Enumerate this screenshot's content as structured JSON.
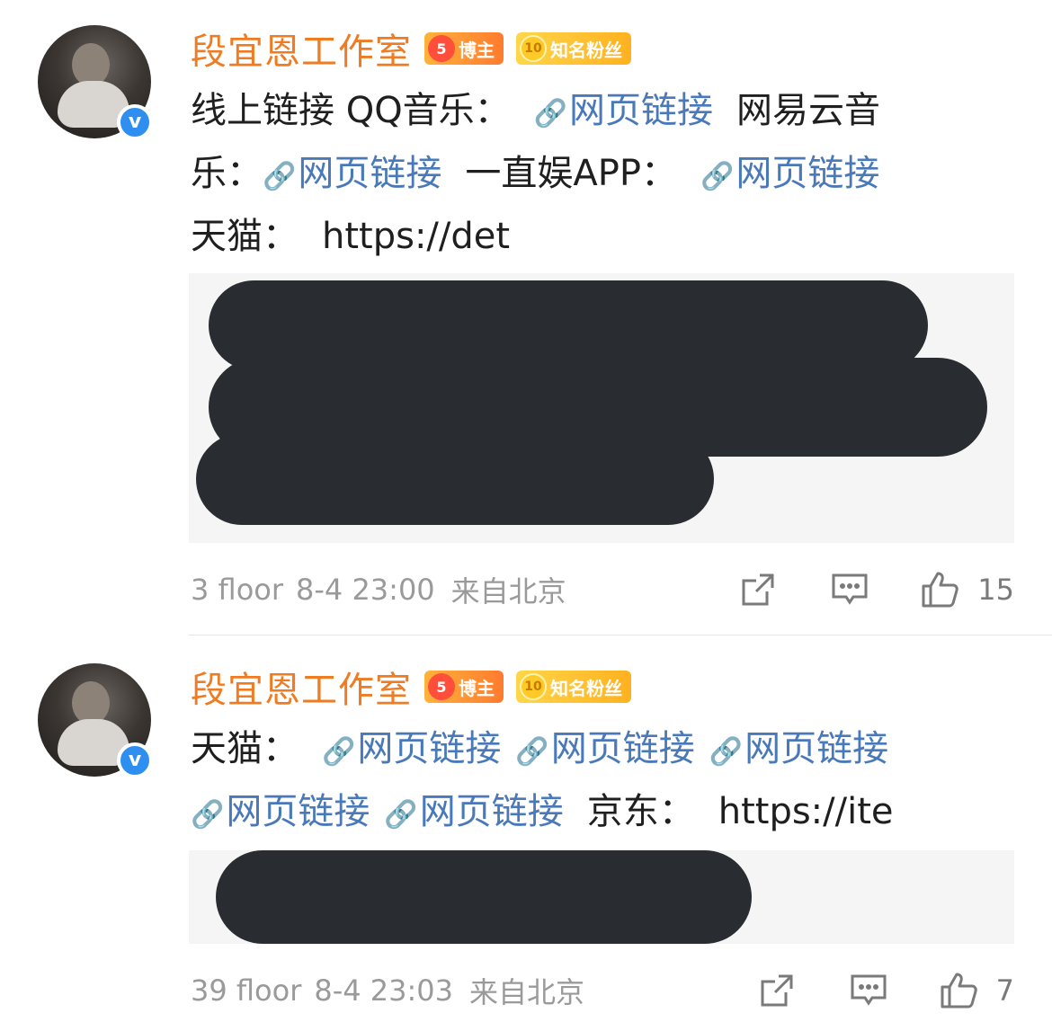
{
  "comments": [
    {
      "author": "段宜恩工作室",
      "badge_blogger": "博主",
      "badge_blogger_level": "5",
      "badge_fans": "知名粉丝",
      "badge_fans_level": "10",
      "lines": [
        {
          "text1": "线上链接 QQ音乐：",
          "link1": "网页链接",
          "text2": "网易云音"
        },
        {
          "text1": "乐：",
          "link1": "网页链接",
          "text2": "一直娱APP：",
          "link2": "网页链接"
        },
        {
          "text1": "天猫：",
          "text2": "https://det"
        }
      ],
      "floor": "3 floor",
      "time": "8-4 23:00",
      "location": "来自北京",
      "likes": "15"
    },
    {
      "author": "段宜恩工作室",
      "badge_blogger": "博主",
      "badge_blogger_level": "5",
      "badge_fans": "知名粉丝",
      "badge_fans_level": "10",
      "lines": [
        {
          "text1": "天猫：",
          "link1": "网页链接",
          "link2": "网页链接",
          "link3": "网页链接"
        },
        {
          "link1": "网页链接",
          "link2": "网页链接",
          "text1": "京东：",
          "text2": "https://ite"
        }
      ],
      "floor": "39 floor",
      "time": "8-4 23:03",
      "location": "来自北京",
      "likes": "7"
    }
  ],
  "icons": {
    "link": "chain-link-icon",
    "share": "share-icon",
    "comment": "comment-icon",
    "like": "thumbs-up-icon",
    "verified": "verified-v-icon"
  },
  "colors": {
    "author": "#ef7b22",
    "link": "#4a79ba",
    "verified": "#2e8ff0",
    "redaction": "#292c30",
    "meta": "#9a9a9a"
  }
}
